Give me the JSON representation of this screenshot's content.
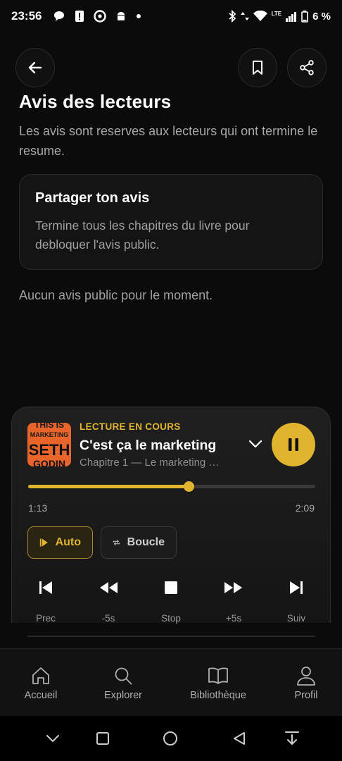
{
  "status_bar": {
    "time": "23:56",
    "network": "LTE",
    "battery": "6 %"
  },
  "header": {
    "back_icon": "arrow-left-icon",
    "bookmark_icon": "bookmark-icon",
    "share_icon": "share-icon"
  },
  "reviews": {
    "title": "Avis des lecteurs",
    "subtitle": "Les avis sont reserves aux lecteurs qui ont termine le resume.",
    "card_title": "Partager ton avis",
    "card_body": "Termine tous les chapitres du livre pour debloquer l'avis public.",
    "empty_text": "Aucun avis public pour le moment."
  },
  "player": {
    "cover_lines": [
      "THIS IS",
      "MARKETING",
      "SETH",
      "GODIN"
    ],
    "label": "LECTURE EN COURS",
    "title": "C'est ça le marketing",
    "subtitle": "Chapitre 1 — Le marketing …",
    "progress": 0.56,
    "current_time": "1:13",
    "total_time": "2:09",
    "auto_label": "Auto",
    "loop_label": "Boucle",
    "controls": [
      "Prec",
      "-5s",
      "Stop",
      "+5s",
      "Suiv"
    ],
    "accent": "#e0b42e"
  },
  "nav": {
    "items": [
      "Accueil",
      "Explorer",
      "Bibliothèque",
      "Profil"
    ]
  }
}
